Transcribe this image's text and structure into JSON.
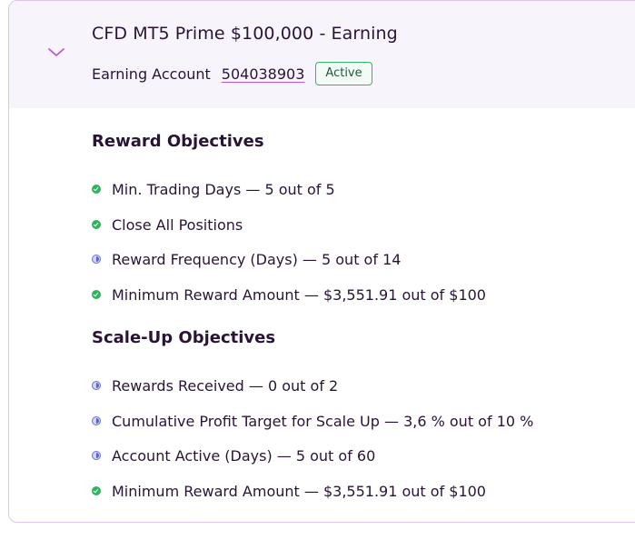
{
  "header": {
    "title": "CFD MT5 Prime $100,000 - Earning",
    "account_label": "Earning Account",
    "account_number": "504038903",
    "status_badge": "Active"
  },
  "reward_section": {
    "title": "Reward Objectives",
    "items": [
      {
        "text": "Min. Trading Days — 5 out of 5",
        "state": "done"
      },
      {
        "text": "Close All Positions",
        "state": "done"
      },
      {
        "text": "Reward Frequency (Days) — 5 out of 14",
        "state": "in-progress"
      },
      {
        "text": "Minimum Reward Amount — $3,551.91 out of $100",
        "state": "done"
      }
    ]
  },
  "scaleup_section": {
    "title": "Scale-Up Objectives",
    "items": [
      {
        "text": "Rewards Received — 0 out of 2",
        "state": "in-progress"
      },
      {
        "text": "Cumulative Profit Target for Scale Up — 3,6 % out of 10 %",
        "state": "in-progress"
      },
      {
        "text": "Account Active (Days) — 5 out of 60",
        "state": "in-progress"
      },
      {
        "text": "Minimum Reward Amount — $3,551.91 out of $100",
        "state": "done"
      }
    ]
  },
  "colors": {
    "done": "#2fb35f",
    "in_progress": "#5a5fcf",
    "border": "#dcc6e8",
    "header_bg": "#f8f4fb",
    "text": "#2a1436",
    "badge_border": "#34b36a"
  },
  "icons": {
    "collapse_toggle": "chevron-down-icon",
    "done": "check-circle-icon",
    "in_progress": "half-circle-progress-icon"
  }
}
